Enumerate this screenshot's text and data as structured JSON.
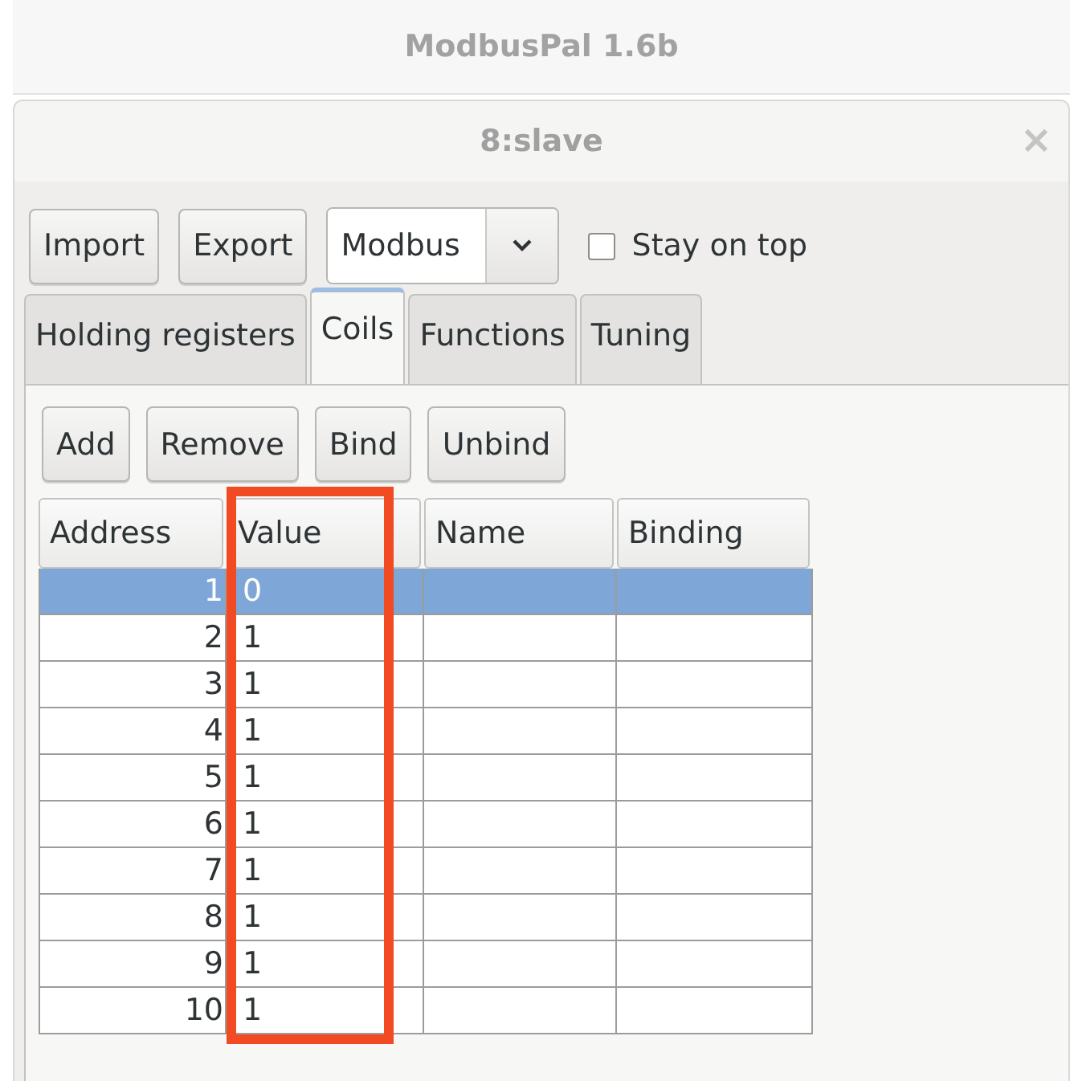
{
  "app_title": "ModbusPal 1.6b",
  "window": {
    "title": "8:slave",
    "close": "×"
  },
  "toolbar": {
    "buttons": [
      "Import",
      "Export"
    ],
    "protocol": {
      "value": "Modbus"
    },
    "stay_on_top": {
      "label": "Stay on top",
      "checked": false
    }
  },
  "tabs": [
    {
      "label": "Holding registers",
      "selected": false
    },
    {
      "label": "Coils",
      "selected": true
    },
    {
      "label": "Functions",
      "selected": false
    },
    {
      "label": "Tuning",
      "selected": false
    }
  ],
  "actions": [
    "Add",
    "Remove",
    "Bind",
    "Unbind"
  ],
  "table": {
    "columns": [
      "Address",
      "Value",
      "Name",
      "Binding"
    ],
    "rows": [
      {
        "address": "1",
        "value": "0",
        "selected": true
      },
      {
        "address": "2",
        "value": "1",
        "selected": false
      },
      {
        "address": "3",
        "value": "1",
        "selected": false
      },
      {
        "address": "4",
        "value": "1",
        "selected": false
      },
      {
        "address": "5",
        "value": "1",
        "selected": false
      },
      {
        "address": "6",
        "value": "1",
        "selected": false
      },
      {
        "address": "7",
        "value": "1",
        "selected": false
      },
      {
        "address": "8",
        "value": "1",
        "selected": false
      },
      {
        "address": "9",
        "value": "1",
        "selected": false
      },
      {
        "address": "10",
        "value": "1",
        "selected": false
      }
    ]
  },
  "annotation": {
    "kind": "highlight"
  }
}
